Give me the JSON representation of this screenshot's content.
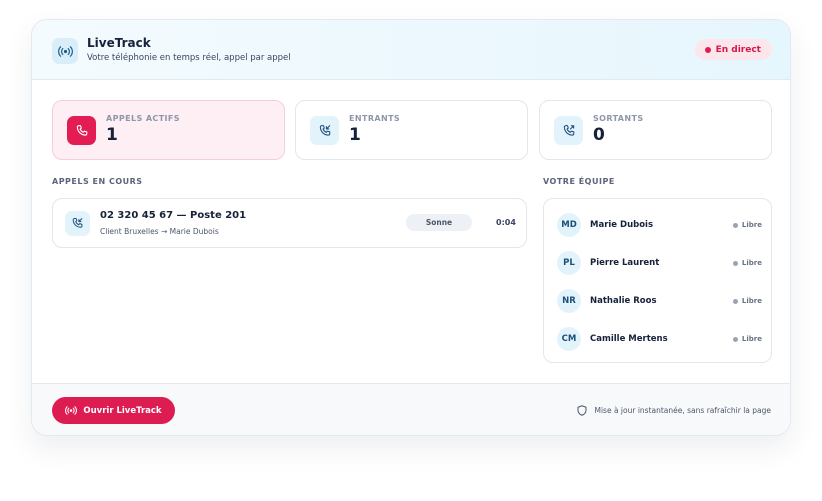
{
  "header": {
    "title": "LiveTrack",
    "subtitle": "Votre téléphonie en temps réel, appel par appel",
    "badge": "En direct"
  },
  "stats": [
    {
      "label": "APPELS ACTIFS",
      "value": "1",
      "icon": "phone-icon"
    },
    {
      "label": "ENTRANTS",
      "value": "1",
      "icon": "incoming-call-icon"
    },
    {
      "label": "SORTANTS",
      "value": "0",
      "icon": "outgoing-call-icon"
    }
  ],
  "calls": {
    "title": "APPELS EN COURS",
    "items": [
      {
        "number": "02 320 45 67 — Poste 201",
        "route": "Client Bruxelles → Marie Dubois",
        "status": "Sonne",
        "duration": "0:04",
        "icon": "incoming-call-icon"
      }
    ]
  },
  "team": {
    "title": "VOTRE ÉQUIPE",
    "members": [
      {
        "initials": "MD",
        "name": "Marie Dubois",
        "status": "Libre"
      },
      {
        "initials": "PL",
        "name": "Pierre Laurent",
        "status": "Libre"
      },
      {
        "initials": "NR",
        "name": "Nathalie Roos",
        "status": "Libre"
      },
      {
        "initials": "CM",
        "name": "Camille Mertens",
        "status": "Libre"
      }
    ]
  },
  "footer": {
    "button": "Ouvrir LiveTrack",
    "note": "Mise à jour instantanée, sans rafraîchir la page"
  },
  "colors": {
    "accent": "#e31c54",
    "accent_soft": "#fdeff3",
    "info_soft": "#e3f3fb",
    "text": "#16213a",
    "muted": "#8e97a8"
  }
}
